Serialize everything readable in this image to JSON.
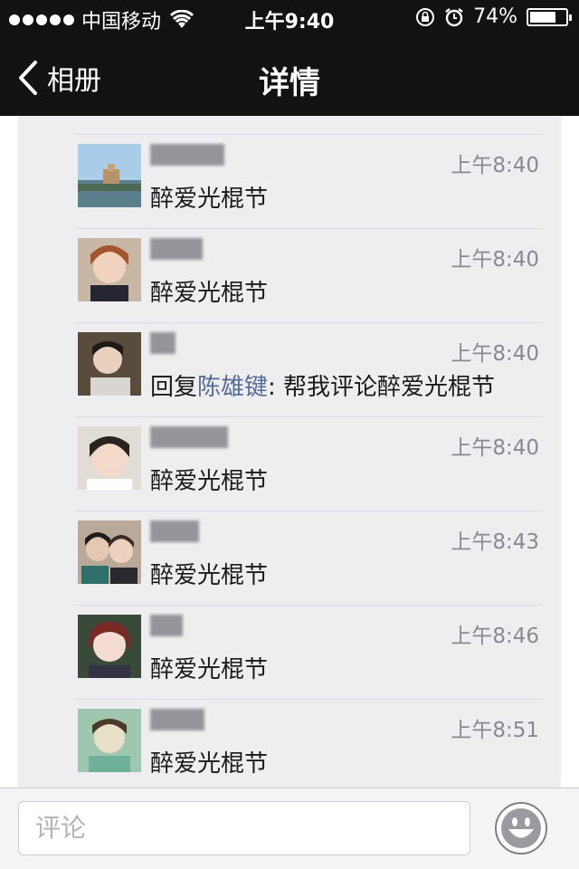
{
  "status_bar": {
    "carrier": "中国移动",
    "time": "上午9:40",
    "battery": "74%",
    "battery_level": 0.74,
    "icons": [
      "signal-dots-icon",
      "wifi-icon",
      "rotation-lock-icon",
      "alarm-icon",
      "battery-icon"
    ]
  },
  "nav": {
    "back_label": "相册",
    "title": "详情"
  },
  "comments": [
    {
      "time": "上午8:40",
      "text": "醉爱光棍节"
    },
    {
      "time": "上午8:40",
      "text": "醉爱光棍节"
    },
    {
      "time": "上午8:40",
      "reply_prefix": "回复",
      "reply_to": "陈雄键",
      "reply_text": ": 帮我评论醉爱光棍节"
    },
    {
      "time": "上午8:40",
      "text": "醉爱光棍节"
    },
    {
      "time": "上午8:43",
      "text": "醉爱光棍节"
    },
    {
      "time": "上午8:46",
      "text": "醉爱光棍节"
    },
    {
      "time": "上午8:51",
      "text": "醉爱光棍节"
    }
  ],
  "input": {
    "placeholder": "评论"
  },
  "colors": {
    "bar_bg": "#121212",
    "list_bg": "#eeeef1",
    "link": "#576b95",
    "time": "#8a8a8e"
  }
}
